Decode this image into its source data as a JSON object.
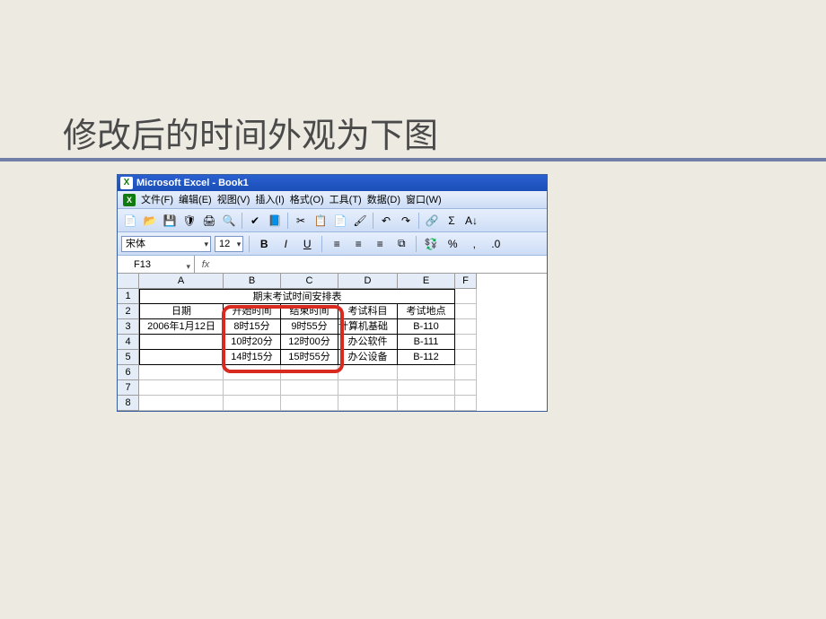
{
  "slide": {
    "title": "修改后的时间外观为下图"
  },
  "app": {
    "title": "Microsoft Excel - Book1"
  },
  "menu": {
    "file": "文件(F)",
    "edit": "编辑(E)",
    "view": "视图(V)",
    "insert": "插入(I)",
    "format": "格式(O)",
    "tools": "工具(T)",
    "data": "数据(D)",
    "window": "窗口(W)"
  },
  "format": {
    "font": "宋体",
    "size": "12"
  },
  "namebox": "F13",
  "fx": "fx",
  "columns": [
    "A",
    "B",
    "C",
    "D",
    "E",
    "F"
  ],
  "rows": [
    "1",
    "2",
    "3",
    "4",
    "5",
    "6",
    "7",
    "8"
  ],
  "table": {
    "title": "期末考试时间安排表",
    "headers": {
      "date": "日期",
      "start": "开始时间",
      "end": "结束时间",
      "subject": "考试科目",
      "location": "考试地点"
    },
    "r3": {
      "date": "2006年1月12日",
      "start": "8时15分",
      "end": "9时55分",
      "subject": "计算机基础",
      "location": "B-110"
    },
    "r4": {
      "date": "",
      "start": "10时20分",
      "end": "12时00分",
      "subject": "办公软件",
      "location": "B-111"
    },
    "r5": {
      "date": "",
      "start": "14时15分",
      "end": "15时55分",
      "subject": "办公设备",
      "location": "B-112"
    }
  },
  "chart_data": {
    "type": "table",
    "title": "期末考试时间安排表",
    "columns": [
      "日期",
      "开始时间",
      "结束时间",
      "考试科目",
      "考试地点"
    ],
    "rows": [
      [
        "2006年1月12日",
        "8时15分",
        "9时55分",
        "计算机基础",
        "B-110"
      ],
      [
        "",
        "10时20分",
        "12时00分",
        "办公软件",
        "B-111"
      ],
      [
        "",
        "14时15分",
        "15时55分",
        "办公设备",
        "B-112"
      ]
    ]
  }
}
